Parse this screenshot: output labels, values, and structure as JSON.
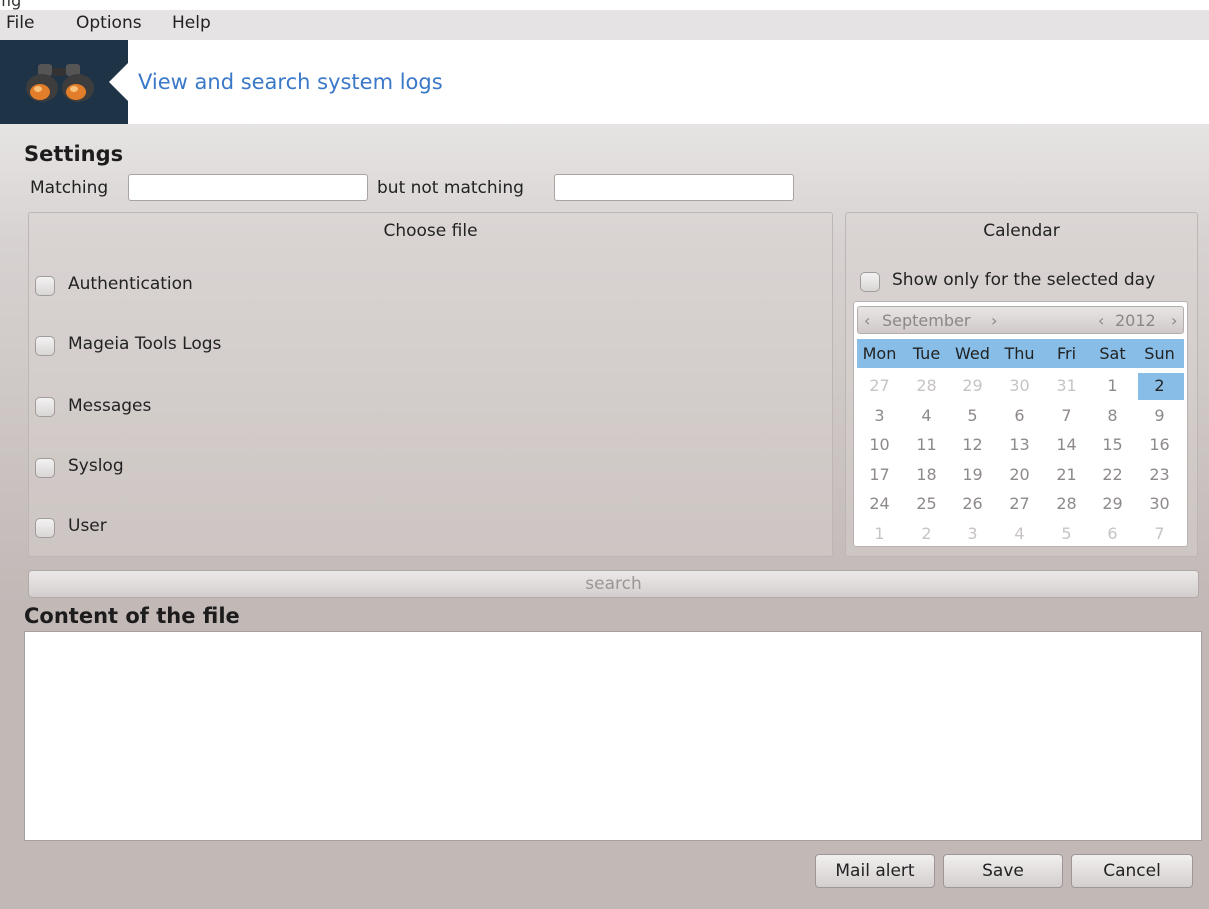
{
  "window": {
    "top_cutoff_text": "fig"
  },
  "menu": {
    "items": [
      "File",
      "Options",
      "Help"
    ]
  },
  "banner": {
    "title": "View and search system logs",
    "icon": "binoculars-icon"
  },
  "settings": {
    "heading": "Settings",
    "matching_label": "Matching",
    "matching_value": "",
    "not_matching_label": "but not matching",
    "not_matching_value": ""
  },
  "choose_file": {
    "title": "Choose file",
    "options": [
      {
        "label": "Authentication",
        "checked": false
      },
      {
        "label": "Mageia Tools Logs",
        "checked": false
      },
      {
        "label": "Messages",
        "checked": false
      },
      {
        "label": "Syslog",
        "checked": false
      },
      {
        "label": "User",
        "checked": false
      }
    ]
  },
  "calendar": {
    "title": "Calendar",
    "show_only_label": "Show only for the selected day",
    "show_only_checked": false,
    "month": "September",
    "year": "2012",
    "weekdays": [
      "Mon",
      "Tue",
      "Wed",
      "Thu",
      "Fri",
      "Sat",
      "Sun"
    ],
    "weeks": [
      [
        "27",
        "28",
        "29",
        "30",
        "31",
        "1",
        "2"
      ],
      [
        "3",
        "4",
        "5",
        "6",
        "7",
        "8",
        "9"
      ],
      [
        "10",
        "11",
        "12",
        "13",
        "14",
        "15",
        "16"
      ],
      [
        "17",
        "18",
        "19",
        "20",
        "21",
        "22",
        "23"
      ],
      [
        "24",
        "25",
        "26",
        "27",
        "28",
        "29",
        "30"
      ],
      [
        "1",
        "2",
        "3",
        "4",
        "5",
        "6",
        "7"
      ]
    ],
    "selected_day": "2"
  },
  "search": {
    "label": "search"
  },
  "content": {
    "heading": "Content of the file",
    "text": ""
  },
  "buttons": {
    "mail_alert": "Mail alert",
    "save": "Save",
    "cancel": "Cancel"
  }
}
